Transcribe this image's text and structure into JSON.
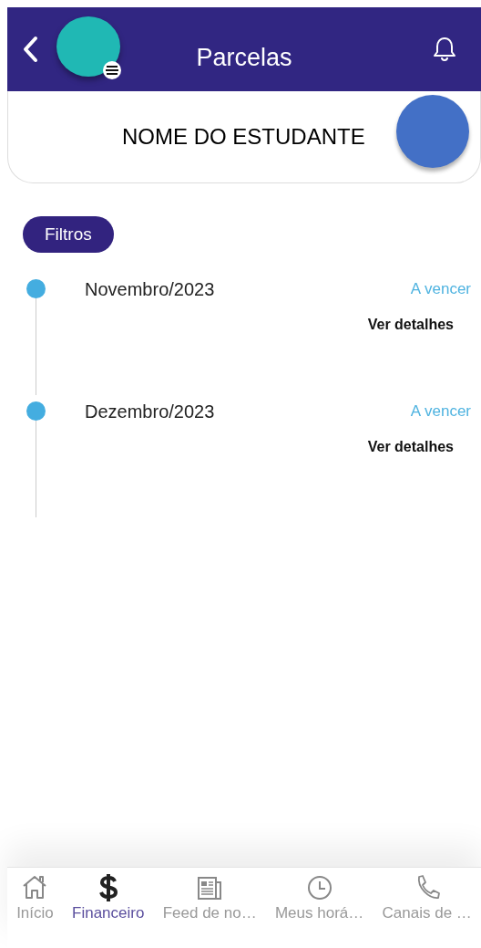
{
  "header": {
    "title": "Parcelas"
  },
  "student": {
    "name": "NOME DO ESTUDANTE"
  },
  "filter_button": {
    "label": "Filtros"
  },
  "installments": [
    {
      "month": "Novembro/2023",
      "status": "A vencer",
      "link": "Ver detalhes"
    },
    {
      "month": "Dezembro/2023",
      "status": "A vencer",
      "link": "Ver detalhes"
    }
  ],
  "bottom_nav": [
    {
      "label": "Início",
      "kind": "home",
      "selected": false
    },
    {
      "label": "Financeiro",
      "kind": "money",
      "selected": true
    },
    {
      "label": "Feed de no…",
      "kind": "news",
      "selected": false
    },
    {
      "label": "Meus horá…",
      "kind": "clock",
      "selected": false
    },
    {
      "label": "Canais de …",
      "kind": "phone",
      "selected": false
    }
  ]
}
